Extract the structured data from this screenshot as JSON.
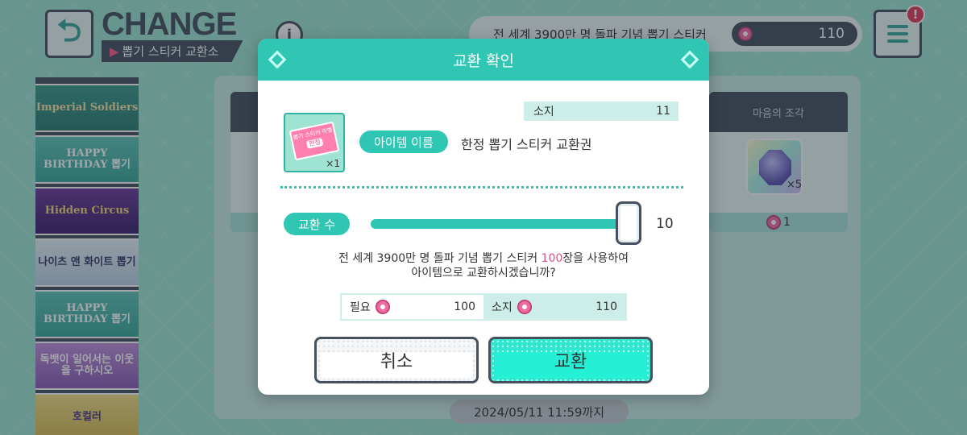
{
  "header": {
    "title": "CHANGE",
    "subtitle": "뽑기 스티커 교환소",
    "currency_label": "전 세계 3900만 명 돌파 기념 뽑기 스티커",
    "currency_amount": "110",
    "notification_badge": "!"
  },
  "sidebar": {
    "banners": [
      {
        "label": "Imperial Soldiers"
      },
      {
        "label": "HAPPY BIRTHDAY 뽑기"
      },
      {
        "label": "Hidden Circus"
      },
      {
        "label": "나이츠 앤 화이트 뽑기"
      },
      {
        "label": "HAPPY BIRTHDAY 뽑기"
      },
      {
        "label": "독뱃이 일어서는 이웃을 구하시오"
      },
      {
        "label": "호컬러"
      }
    ]
  },
  "background_panel": {
    "card_header": "마음의 조각",
    "card_qty": "×5",
    "card_cost": "1",
    "deadline": "2024/05/11 11:59까지"
  },
  "dialog": {
    "title": "교환 확인",
    "owned_label": "소지",
    "owned_value": "11",
    "item_name_label": "아이템 이름",
    "item_name": "한정 뽑기 스티커 교환권",
    "item_qty": "×1",
    "ticket_text": "뽑기 스티커 라벨",
    "ticket_tag": "한정",
    "count_label": "교환 수",
    "count_value": "10",
    "slider_fraction": 1.0,
    "prompt_before": "전 세계 3900만 명 돌파 기념 뽑기 스티커 ",
    "prompt_highlight": "100",
    "prompt_after": "장을 사용하여",
    "prompt_line2": "아이템으로 교환하시겠습니까?",
    "need_label": "필요",
    "need_value": "100",
    "have_label": "소지",
    "have_value": "110",
    "cancel_label": "취소",
    "confirm_label": "교환"
  },
  "colors": {
    "accent": "#2fc6b4",
    "dark": "#46505e",
    "highlight": "#e0508a"
  }
}
